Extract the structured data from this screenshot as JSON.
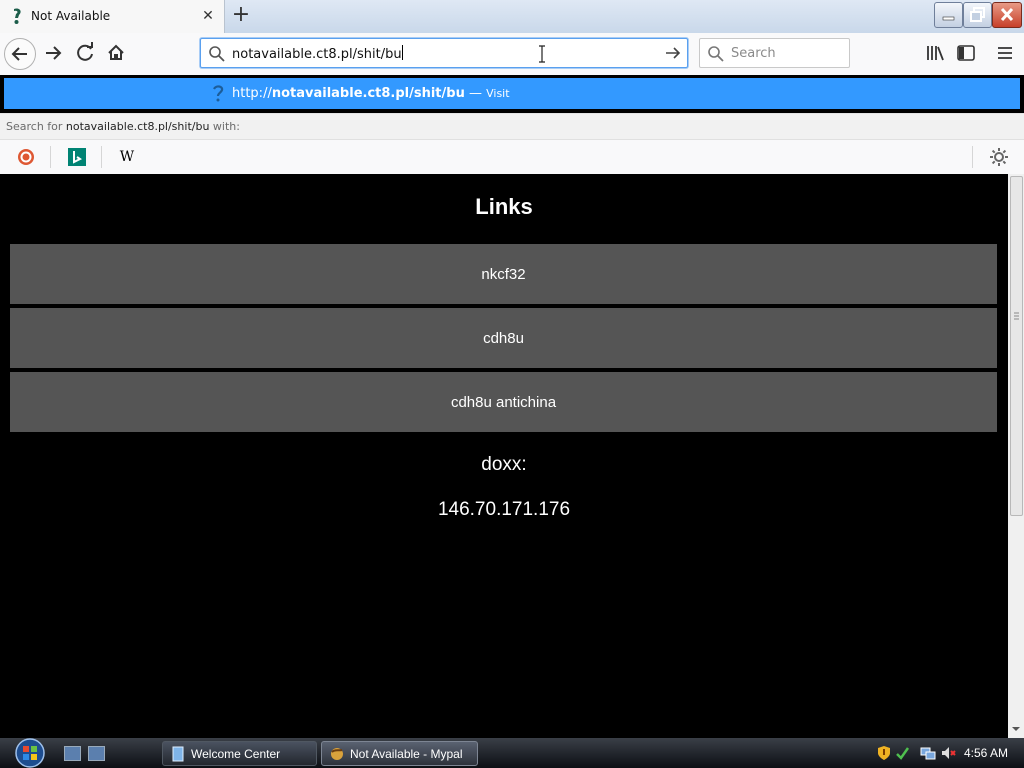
{
  "browser": {
    "tab": {
      "title": "Not Available",
      "close_glyph": "✕"
    },
    "new_tab_glyph": "+",
    "url": "notavailable.ct8.pl/shit/bu",
    "search_placeholder": "Search",
    "suggestion": {
      "prefix": "http://",
      "bold": "notavailable.ct8.pl/shit/bu",
      "sep": " — ",
      "action": "Visit"
    },
    "search_for": {
      "prefix": "Search for ",
      "query": "notavailable.ct8.pl/shit/bu",
      "suffix": " with:"
    },
    "engines": {
      "wikipedia_glyph": "W"
    },
    "icons": [
      "back-icon",
      "forward-icon",
      "reload-icon",
      "home-icon",
      "search-icon",
      "arrow-right-icon",
      "library-icon",
      "sidebar-icon",
      "hamburger-menu-icon",
      "gear-icon"
    ],
    "accent": "#3399ff"
  },
  "page": {
    "title": "Links",
    "links": [
      "nkcf32",
      "cdh8u",
      "cdh8u antichina"
    ],
    "doxx_label": "doxx:",
    "doxx_value": "146.70.171.176",
    "background": "#000000",
    "button_color": "#555555"
  },
  "taskbar": {
    "tasks": [
      "Welcome Center",
      "Not Available - Mypal"
    ],
    "clock": "4:56 AM"
  }
}
